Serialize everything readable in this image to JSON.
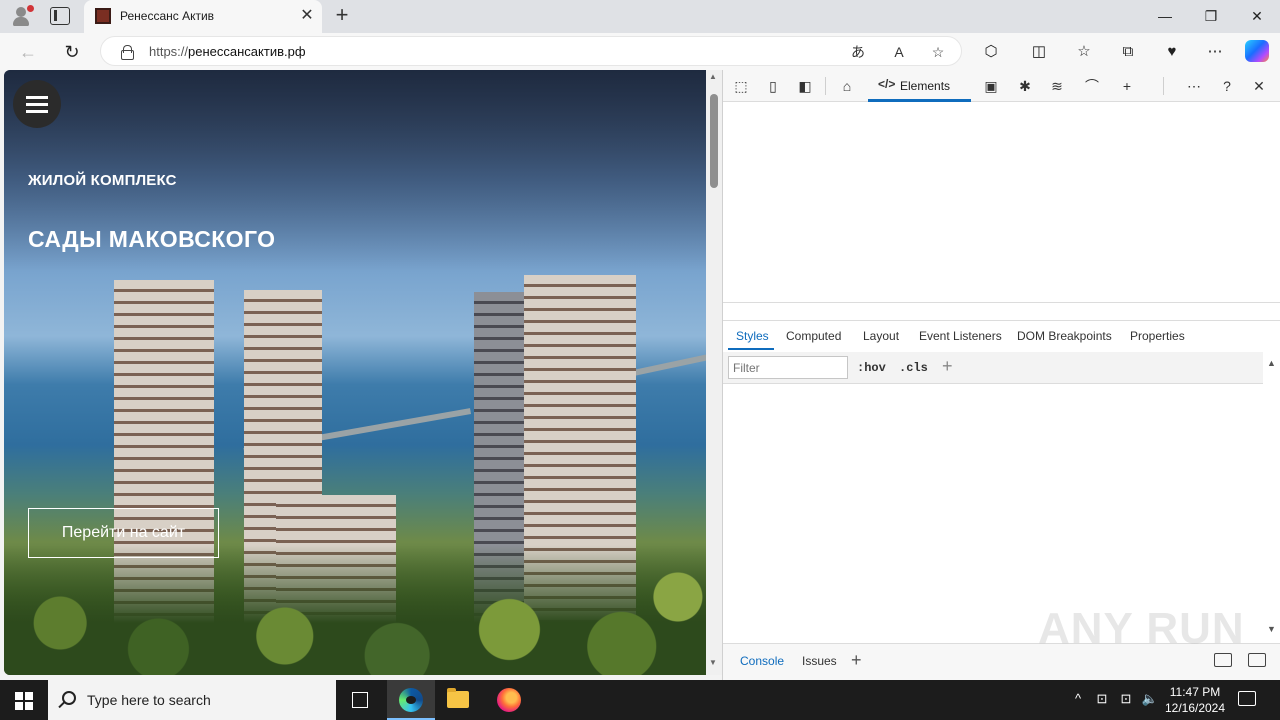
{
  "browser": {
    "tab_title": "Ренессанс Актив",
    "tab_close_glyph": "✕",
    "new_tab_glyph": "+",
    "url_scheme": "https://",
    "url_host": "ренессансактив.рф",
    "window_controls": {
      "minimize": "—",
      "maximize": "❐",
      "close": "✕"
    },
    "nav_glyphs": {
      "back": "←",
      "refresh": "↻"
    },
    "toolbar_glyphs": {
      "translate": "あ",
      "read_aloud": "A",
      "favorite": "☆",
      "extensions": "⬡",
      "split": "◫",
      "favorites": "☆",
      "collections": "⧉",
      "health": "♥",
      "more": "⋯"
    }
  },
  "page": {
    "hero_subtitle": "ЖИЛОЙ КОМПЛЕКС",
    "hero_title": "САДЫ МАКОВСКОГО",
    "cta_label": "Перейти на сайт"
  },
  "devtools": {
    "main_tab": "Elements",
    "code_glyph": "</>",
    "toolbar_glyphs": {
      "inspect": "⬚",
      "device": "▯",
      "dock": "◧",
      "home": "⌂",
      "console": "▣",
      "sources": "✱",
      "network": "≋",
      "performance": "⌒",
      "add": "+",
      "more": "⋯",
      "help": "?",
      "close": "✕"
    },
    "styles_tabs": [
      "Styles",
      "Computed",
      "Layout",
      "Event Listeners",
      "DOM Breakpoints",
      "Properties"
    ],
    "filter_placeholder": "Filter",
    "hov_label": ":hov",
    "cls_label": ".cls",
    "add_rule_glyph": "+",
    "drawer_tabs": [
      "Console",
      "Issues"
    ],
    "drawer_add_glyph": "+"
  },
  "watermark": "ANY RUN",
  "taskbar": {
    "search_placeholder": "Type here to search",
    "time": "11:47 PM",
    "date": "12/16/2024",
    "tray_glyphs": {
      "chevron": "^",
      "network": "⊡",
      "volume": "🔈"
    }
  },
  "colors": {
    "accent": "#0f6cbd",
    "taskbar": "#1c1c1c"
  }
}
